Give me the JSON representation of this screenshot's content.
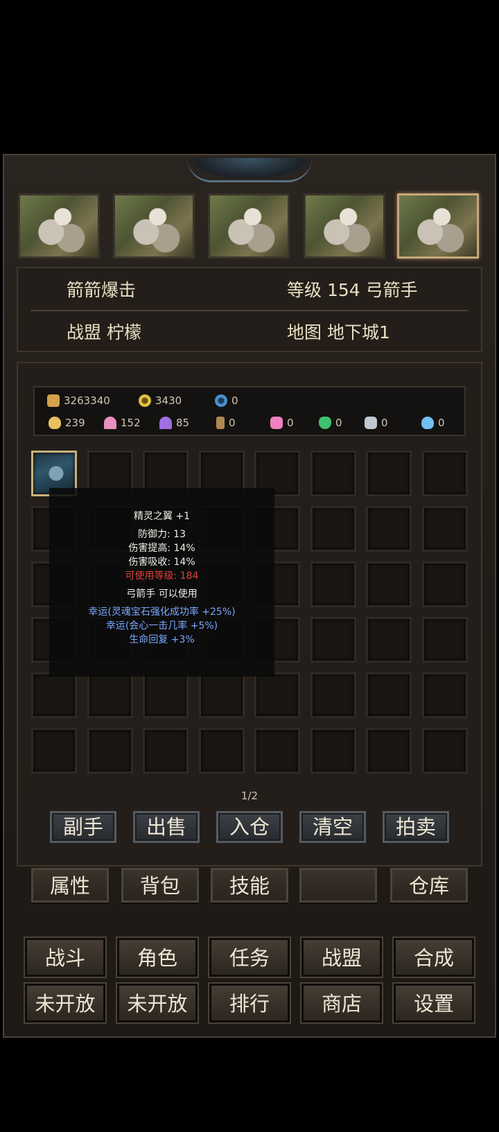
{
  "character": {
    "name": "箭箭爆击",
    "level_text": "等级 154 弓箭手",
    "guild_text": "战盟 柠檬",
    "map_text": "地图 地下城1"
  },
  "resources": {
    "row1": [
      {
        "icon": "gold-coins-icon",
        "value": "3263340",
        "color": "#d4a24a"
      },
      {
        "icon": "gold-medal-icon",
        "value": "3430",
        "color": "#e0c040"
      },
      {
        "icon": "blue-gem-icon",
        "value": "0",
        "color": "#4a90d0"
      }
    ],
    "row2": [
      {
        "icon": "yellow-crystal-icon",
        "value": "239",
        "color": "#e8c060"
      },
      {
        "icon": "pink-mushroom-icon",
        "value": "152",
        "color": "#e890c0"
      },
      {
        "icon": "purple-mushroom-icon",
        "value": "85",
        "color": "#a070e0"
      },
      {
        "icon": "scroll-icon",
        "value": "0",
        "color": "#b08850"
      },
      {
        "icon": "pink-diamond-icon",
        "value": "0",
        "color": "#f080c0"
      },
      {
        "icon": "green-crystal-icon",
        "value": "0",
        "color": "#40c070"
      },
      {
        "icon": "silver-ore-icon",
        "value": "0",
        "color": "#c0c8d0"
      },
      {
        "icon": "blue-crystal-icon",
        "value": "0",
        "color": "#70c0f0"
      }
    ]
  },
  "tooltip": {
    "item_name": "精灵之翼 +1",
    "stats": [
      "防御力: 13",
      "伤害提高: 14%",
      "伤害吸收: 14%"
    ],
    "level_req": "可使用等级: 184",
    "class_req": "弓箭手 可以使用",
    "bonuses": [
      "幸运(灵魂宝石强化成功率 +25%)",
      "幸运(会心一击几率 +5%)",
      "生命回复 +3%"
    ]
  },
  "page": "1/2",
  "actions": [
    "副手",
    "出售",
    "入仓",
    "清空",
    "拍卖"
  ],
  "tabs": [
    "属性",
    "背包",
    "技能",
    "",
    "仓库"
  ],
  "menu": [
    "战斗",
    "角色",
    "任务",
    "战盟",
    "合成",
    "未开放",
    "未开放",
    "排行",
    "商店",
    "设置"
  ],
  "colors": {
    "level_req": "#e0403a",
    "bonus": "#7aa8ff"
  }
}
